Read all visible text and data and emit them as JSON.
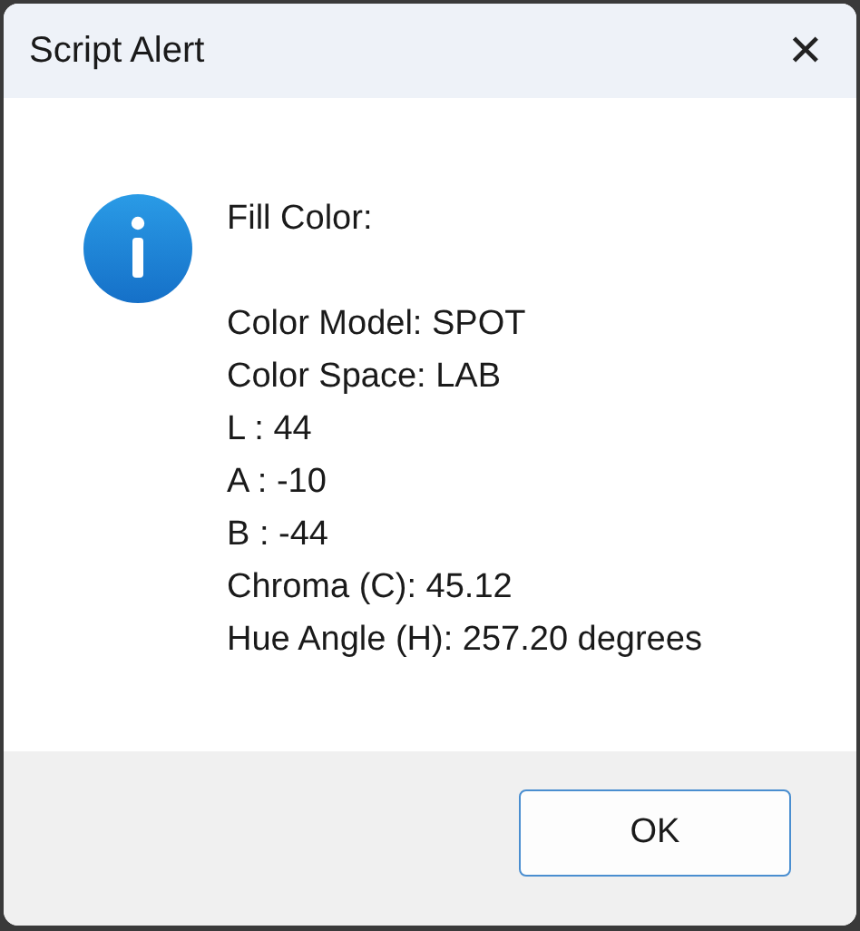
{
  "window": {
    "title": "Script Alert",
    "close": "✕"
  },
  "message": {
    "heading": "Fill Color:",
    "lines": [
      "Color Model: SPOT",
      "Color Space: LAB",
      "L : 44",
      "A : -10",
      "B : -44",
      "Chroma (C): 45.12",
      "Hue Angle (H): 257.20 degrees"
    ]
  },
  "buttons": [
    "OK"
  ]
}
